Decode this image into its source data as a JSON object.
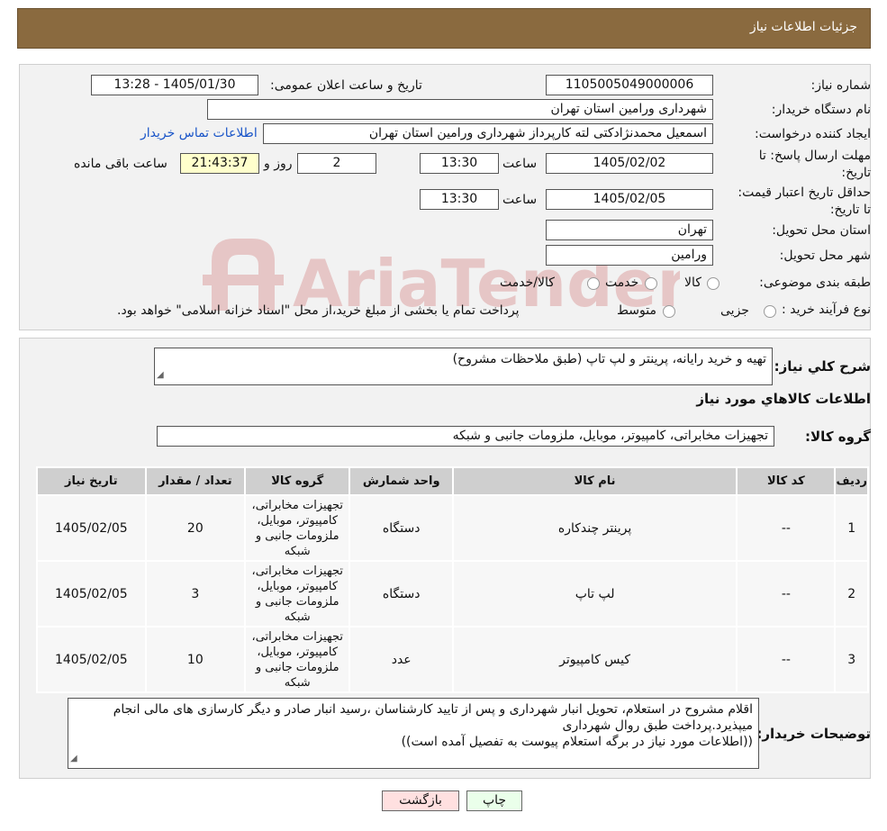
{
  "header": {
    "title": "جزئیات اطلاعات نیاز"
  },
  "form": {
    "need_number_label": "شماره نیاز:",
    "need_number": "1105005049000006",
    "announce_label": "تاریخ و ساعت اعلان عمومی:",
    "announce_value": "1405/01/30 - 13:28",
    "buyer_org_label": "نام دستگاه خریدار:",
    "buyer_org": "شهرداری ورامین استان تهران",
    "requester_label": "ایجاد کننده درخواست:",
    "requester": "اسمعیل محمدنژادکتی لته کارپرداز شهرداری ورامین استان تهران",
    "contact_link": "اطلاعات تماس خریدار",
    "reply_deadline_label": "مهلت ارسال پاسخ: تا تاریخ:",
    "reply_date": "1405/02/02",
    "time_label": "ساعت",
    "reply_time": "13:30",
    "days_value": "2",
    "days_label": "روز و",
    "remaining_time": "21:43:37",
    "remaining_label": "ساعت باقی مانده",
    "price_validity_label": "حداقل تاریخ اعتبار قیمت: تا تاریخ:",
    "price_date": "1405/02/05",
    "price_time": "13:30",
    "province_label": "استان محل تحویل:",
    "province": "تهران",
    "city_label": "شهر محل تحویل:",
    "city": "ورامین",
    "category_label": "طبقه بندی موضوعی:",
    "category_options": [
      "کالا",
      "خدمت",
      "کالا/خدمت"
    ],
    "process_label": "نوع فرآیند خرید :",
    "process_options": [
      "جزیی",
      "متوسط"
    ],
    "process_note": "پرداخت تمام یا بخشی از مبلغ خرید،از محل \"اسناد خزانه اسلامی\" خواهد بود."
  },
  "details": {
    "summary_label": "شرح کلي نياز:",
    "summary": "تهیه و خرید رایانه، پرینتر و لپ تاپ (طبق ملاحظات مشروح)",
    "items_heading": "اطلاعات کالاهاي مورد نياز",
    "group_label": "گروه کالا:",
    "group_value": "تجهیزات مخابراتی، کامپیوتر، موبایل، ملزومات جانبی و شبکه"
  },
  "table": {
    "headers": [
      "ردیف",
      "کد کالا",
      "نام کالا",
      "واحد شمارش",
      "گروه کالا",
      "تعداد / مقدار",
      "تاریخ نیاز"
    ],
    "rows": [
      {
        "row": "1",
        "code": "--",
        "name": "پرینتر چندکاره",
        "unit": "دستگاه",
        "group": "تجهیزات مخابراتی، کامپیوتر، موبایل، ملزومات جانبی و شبکه",
        "qty": "20",
        "date": "1405/02/05"
      },
      {
        "row": "2",
        "code": "--",
        "name": "لپ تاپ",
        "unit": "دستگاه",
        "group": "تجهیزات مخابراتی، کامپیوتر، موبایل، ملزومات جانبی و شبکه",
        "qty": "3",
        "date": "1405/02/05"
      },
      {
        "row": "3",
        "code": "--",
        "name": "کیس کامپیوتر",
        "unit": "عدد",
        "group": "تجهیزات مخابراتی، کامپیوتر، موبایل، ملزومات جانبی و شبکه",
        "qty": "10",
        "date": "1405/02/05"
      }
    ]
  },
  "notes": {
    "label": "توضیحات خریدار:",
    "line1": "اقلام مشروح در استعلام، تحویل انبار شهرداری و پس از تایید کارشناسان ،رسید انبار صادر و دیگر کارسازی های مالی انجام میپذیرد.پرداخت طبق روال شهرداری",
    "line2": "((اطلاعات مورد نیاز در برگه استعلام پیوست به تفصیل آمده است))"
  },
  "buttons": {
    "print": "چاپ",
    "back": "بازگشت"
  },
  "watermark": {
    "text": "AriaTender.neT"
  },
  "colors": {
    "header_bg": "#8a6a3f",
    "link": "#1a55c8",
    "print_bg": "#eaffea",
    "back_bg": "#ffe0e0",
    "remaining_bg": "#ffffcc"
  }
}
